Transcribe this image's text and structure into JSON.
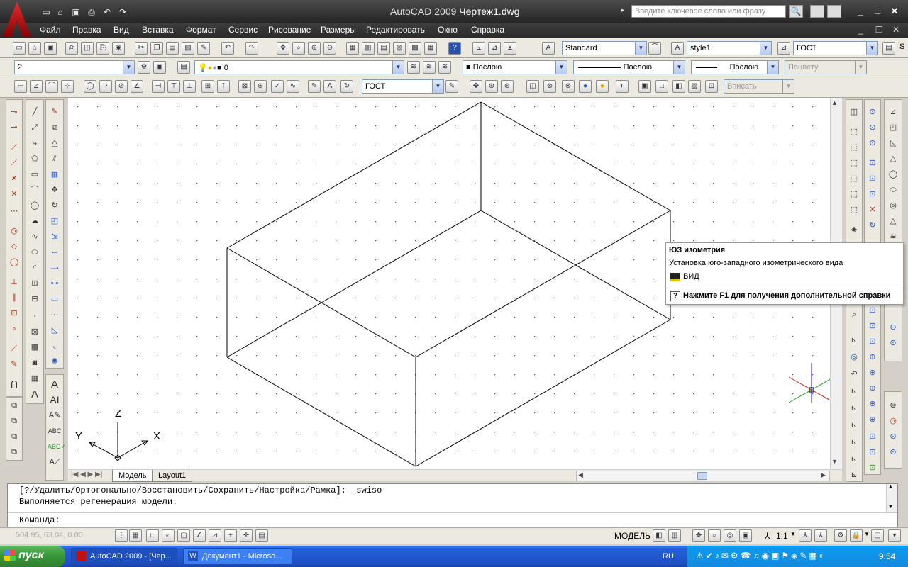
{
  "title_bar": {
    "app_name": "AutoCAD 2009",
    "file_name": "Чертеж1.dwg",
    "search_placeholder": "Введите ключевое слово или фразу"
  },
  "menu": [
    "Файл",
    "Правка",
    "Вид",
    "Вставка",
    "Формат",
    "Сервис",
    "Рисование",
    "Размеры",
    "Редактировать",
    "Окно",
    "Справка"
  ],
  "toolbar_standard": {
    "text_style": "Standard",
    "dim_style": "style1",
    "table_style": "ГОСТ",
    "overflow": "S"
  },
  "toolbar_layers": {
    "layer_left": "2",
    "current_layer": "0",
    "color": "Послою",
    "linetype": "Послою",
    "lineweight": "Послою",
    "plot_style": "Поцвету"
  },
  "toolbar_dimensions": {
    "dim_style": "ГОСТ",
    "zoom_mode": "Вписать"
  },
  "tabs": {
    "model": "Модель",
    "layout1": "Layout1"
  },
  "ucs_labels": {
    "x": "X",
    "y": "Y",
    "z": "Z"
  },
  "tooltip": {
    "title": "ЮЗ изометрия",
    "description": "Установка юго-западного изометрического вида",
    "command": "ВИД",
    "help": "Нажмите F1 для получения дополнительной справки"
  },
  "command_line": {
    "history_1": "[?/Удалить/Ортогонально/Восстановить/Сохранить/Настройка/Рамка]: _swiso",
    "history_2": "Выполняется регенерация модели.",
    "prompt": "Команда:"
  },
  "status_bar": {
    "coordinates": "504.95, 63.04, 0.00",
    "space": "МОДЕЛЬ",
    "scale": "1:1"
  },
  "taskbar": {
    "start": "пуск",
    "task1": "AutoCAD 2009 - [Чер...",
    "task2": "Документ1 - Microso...",
    "lang": "RU",
    "clock": "9:54"
  }
}
